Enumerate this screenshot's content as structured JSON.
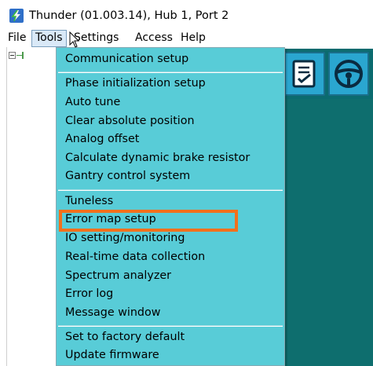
{
  "window": {
    "title": "Thunder (01.003.14), Hub 1, Port 2",
    "icon": "thunder-app-icon"
  },
  "menubar": {
    "items": [
      {
        "label": "File"
      },
      {
        "label": "Tools"
      },
      {
        "label": "Settings"
      },
      {
        "label": "Access"
      },
      {
        "label": "Help"
      }
    ],
    "active": "Tools"
  },
  "tools_menu": {
    "groups": [
      [
        {
          "label": "Communication setup"
        }
      ],
      [
        {
          "label": "Phase initialization setup"
        },
        {
          "label": "Auto tune"
        },
        {
          "label": "Clear absolute position"
        },
        {
          "label": "Analog offset"
        },
        {
          "label": "Calculate dynamic brake resistor"
        },
        {
          "label": "Gantry control system"
        }
      ],
      [
        {
          "label": "Tuneless"
        },
        {
          "label": "Error map setup"
        },
        {
          "label": "IO setting/monitoring"
        },
        {
          "label": "Real-time data collection"
        },
        {
          "label": "Spectrum analyzer"
        },
        {
          "label": "Error log"
        },
        {
          "label": "Message window"
        }
      ],
      [
        {
          "label": "Set to factory default"
        },
        {
          "label": "Update firmware"
        }
      ]
    ],
    "highlighted_item": "Error map setup"
  },
  "toolbar": {
    "buttons": [
      {
        "icon": "document-check-icon"
      },
      {
        "icon": "steering-wheel-icon"
      }
    ]
  },
  "colors": {
    "menu_bg": "#58ccd7",
    "workspace_bg": "#0e6e6e",
    "highlight": "#f2701c",
    "toolbar_button": "#2aa6d0"
  }
}
